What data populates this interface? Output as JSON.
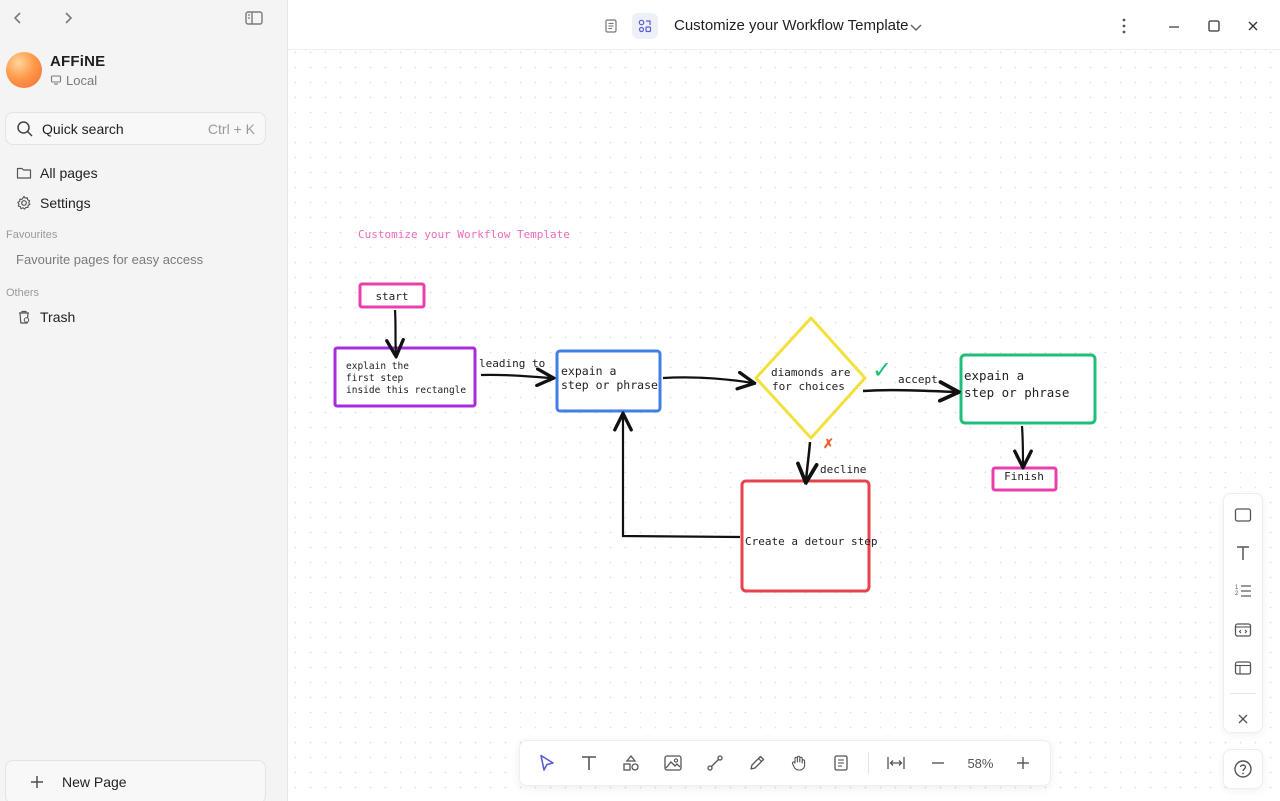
{
  "sidebar": {
    "workspace": {
      "name": "AFFiNE",
      "storage": "Local"
    },
    "search": {
      "label": "Quick search",
      "shortcut": "Ctrl + K"
    },
    "nav": [
      {
        "label": "All pages",
        "icon": "folder-icon"
      },
      {
        "label": "Settings",
        "icon": "gear-icon"
      }
    ],
    "favourites_label": "Favourites",
    "favourites_hint": "Favourite pages for easy access",
    "others_label": "Others",
    "trash_label": "Trash",
    "new_page_label": "New Page"
  },
  "header": {
    "title": "Customize your Workflow Template",
    "mode": "edgeless"
  },
  "canvas": {
    "heading": "Customize your Workflow Template",
    "nodes": {
      "start": "start",
      "explain": [
        "explain the",
        "first step",
        "inside this rectangle"
      ],
      "step1": [
        "expain a",
        "step or phrase"
      ],
      "diamond": [
        "diamonds are",
        "for choices"
      ],
      "step2": [
        "expain a",
        "step or phrase"
      ],
      "finish": "Finish",
      "detour": "Create a detour step"
    },
    "edge_labels": {
      "leading": "leading to",
      "accept": "accept",
      "decline": "decline"
    },
    "accept_mark": "✓",
    "decline_mark": "✗",
    "colors": {
      "start": "#e83fae",
      "explain": "#a92be0",
      "step1": "#3f7fe6",
      "diamond": "#f4e03c",
      "step2": "#1fbf78",
      "finish": "#e83fae",
      "detour": "#e8434d",
      "heading": "#f06aba",
      "check": "#1fbf78",
      "cross": "#f25b2a"
    }
  },
  "bottom_toolbar": {
    "zoom": "58%"
  }
}
